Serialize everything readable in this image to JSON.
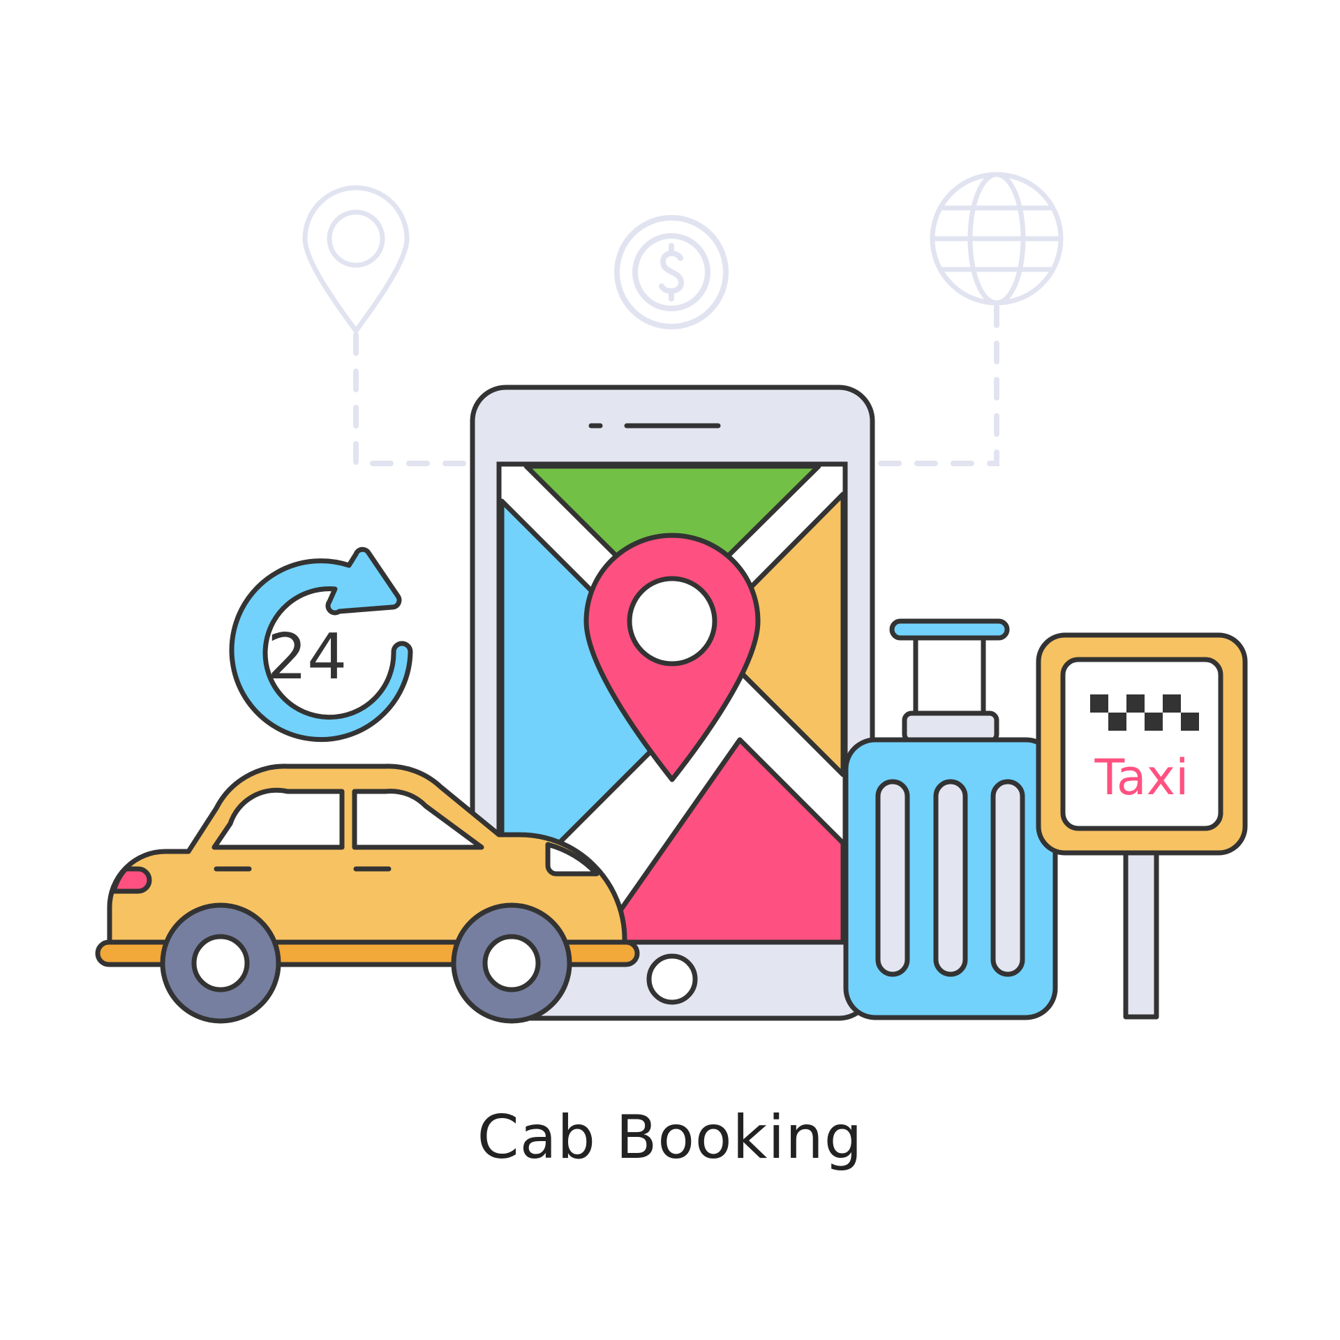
{
  "badge_24_text": "24",
  "taxi_sign_text": "Taxi",
  "caption": "Cab Booking",
  "colors": {
    "outline": "#333333",
    "light_outline": "#E1E4F0",
    "phone_body": "#E3E6F1",
    "map_green": "#72C045",
    "map_blue": "#72D2FB",
    "map_orange": "#F7C262",
    "map_pink": "#FF5181",
    "car_body": "#F7C262",
    "car_stripe": "#F3A83A",
    "wheel": "#767F9F",
    "luggage": "#72D2FB",
    "sign_board": "#F7C262",
    "taxi_text": "#FF5181"
  },
  "icons": [
    "location-pin-icon",
    "dollar-coin-icon",
    "globe-icon",
    "map-pin-icon",
    "24-hours-icon",
    "taxi-car-icon",
    "luggage-icon",
    "taxi-sign-icon"
  ]
}
